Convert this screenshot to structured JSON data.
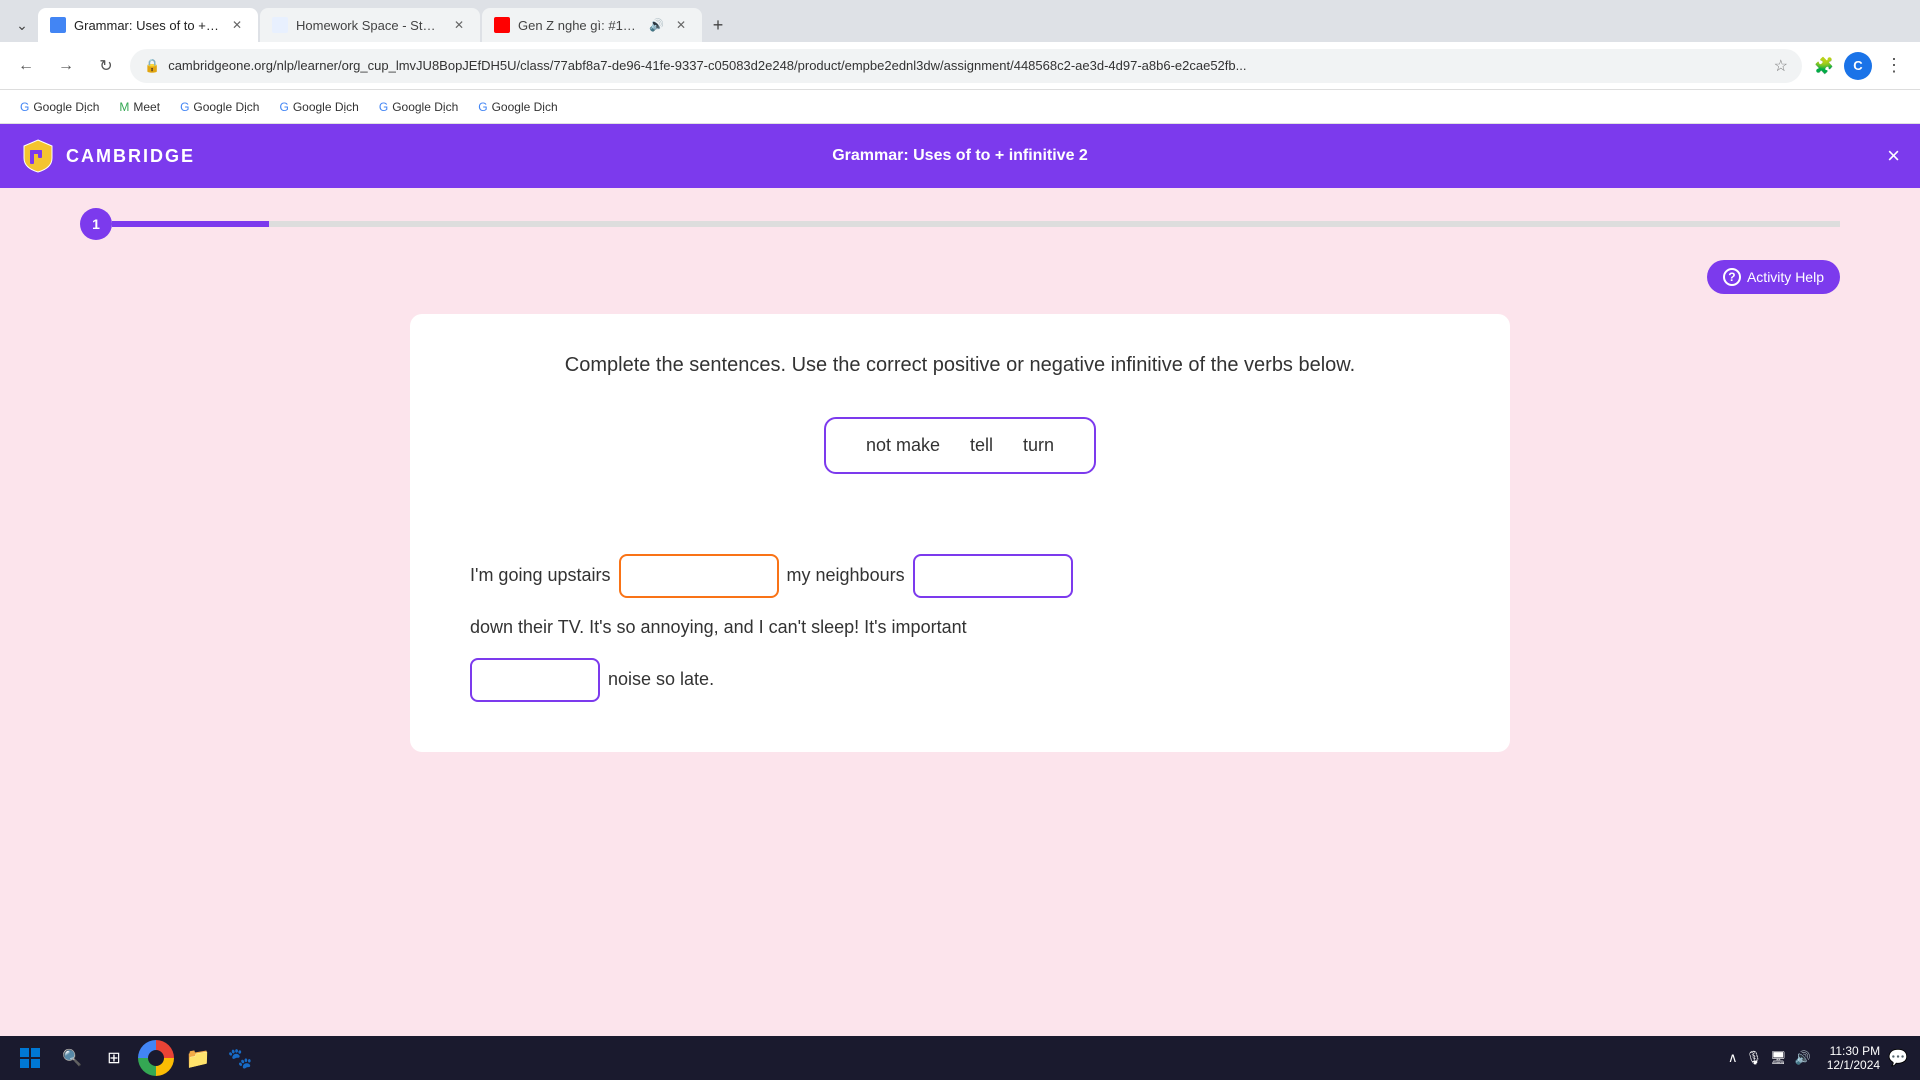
{
  "browser": {
    "tabs": [
      {
        "id": "grammar",
        "title": "Grammar: Uses of to + infinitiv...",
        "active": true,
        "favicon_type": "grammar",
        "has_close": true
      },
      {
        "id": "studyx",
        "title": "Homework Space - StudyX",
        "active": false,
        "favicon_type": "studyx",
        "has_close": true
      },
      {
        "id": "youtube",
        "title": "Gen Z nghe gì: #13 Mùa đ...",
        "active": false,
        "favicon_type": "youtube",
        "has_close": true,
        "has_speaker": true
      }
    ],
    "new_tab_label": "+",
    "address": "cambridgeone.org/nlp/learner/org_cup_lmvJU8BopJEfDH5U/class/77abf8a7-de96-41fe-9337-c05083d2e248/product/empbe2ednl3dw/assignment/448568c2-ae3d-4d97-a8b6-e2cae52fb...",
    "profile_letter": "C",
    "bookmarks": [
      {
        "label": "Google Dịch",
        "favicon": "G"
      },
      {
        "label": "Meet",
        "favicon": "M"
      },
      {
        "label": "Google Dịch",
        "favicon": "G"
      },
      {
        "label": "Google Dịch",
        "favicon": "G"
      },
      {
        "label": "Google Dịch",
        "favicon": "G"
      },
      {
        "label": "Google Dịch",
        "favicon": "G"
      }
    ]
  },
  "cambridge": {
    "logo_text": "CAMBRIDGE",
    "header_title": "Grammar: Uses of to + infinitive 2",
    "close_label": "×"
  },
  "progress": {
    "current_step": "1",
    "total_segments": 11
  },
  "activity_help": {
    "label": "Activity Help",
    "icon": "?"
  },
  "exercise": {
    "instruction": "Complete the sentences. Use the correct positive or negative infinitive of the verbs below.",
    "word_bank": [
      "not make",
      "tell",
      "turn"
    ],
    "sentence_parts": {
      "part1_before": "I'm going upstairs",
      "part1_middle": "my neighbours",
      "part2": "down their TV. It's so annoying, and I can't sleep! It's important",
      "part3_after": "noise so late."
    },
    "inputs": {
      "input1_placeholder": "",
      "input2_placeholder": "",
      "input3_placeholder": ""
    }
  },
  "taskbar": {
    "time": "11:30 PM",
    "date": "12/1/2024"
  }
}
